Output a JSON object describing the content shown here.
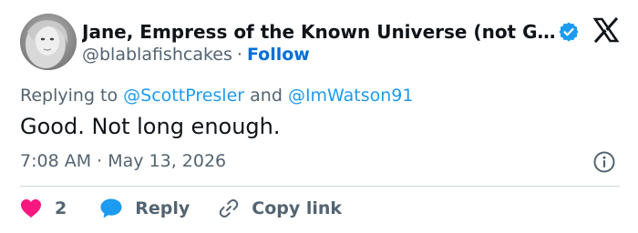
{
  "author": {
    "display_name": "Jane, Empress of the Known Universe (not GP)...",
    "handle": "@blablafishcakes",
    "separator": "·",
    "follow_label": "Follow"
  },
  "reply_context": {
    "prefix": "Replying to",
    "mention_1": "@ScottPresler",
    "conjunction": "and",
    "mention_2": "@ImWatson91"
  },
  "tweet": {
    "text": "Good. Not long enough.",
    "timestamp": "7:08 AM · May 13, 2026"
  },
  "actions": {
    "like_count": "2",
    "reply_label": "Reply",
    "copy_link_label": "Copy link"
  },
  "icons": {
    "verified": "verified-badge-icon",
    "brand": "x-logo-icon",
    "info": "info-icon",
    "like": "heart-icon",
    "reply": "speech-bubble-icon",
    "copy": "link-icon"
  },
  "colors": {
    "text_primary": "#0f1419",
    "text_secondary": "#536471",
    "link_blue": "#006fd6",
    "mention_blue": "#1d9bf0",
    "like_pink": "#f91880",
    "divider": "#cfd9de"
  }
}
